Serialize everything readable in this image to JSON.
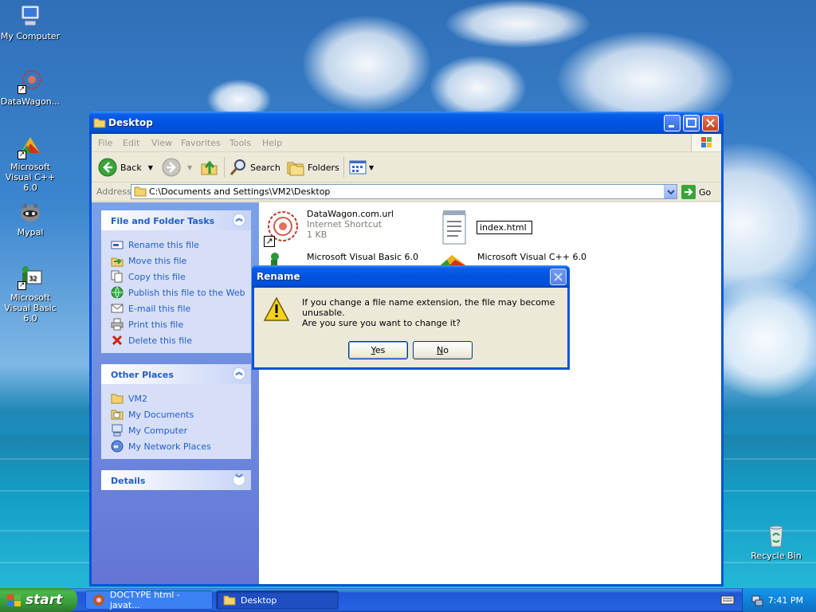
{
  "desktop": {
    "icons": [
      {
        "label": "My Computer"
      },
      {
        "label": "DataWagon..."
      },
      {
        "label": "Microsoft Visual C++ 6.0"
      },
      {
        "label": "Mypal"
      },
      {
        "label": "Microsoft Visual Basic 6.0"
      },
      {
        "label": "Recycle Bin"
      }
    ]
  },
  "explorer": {
    "title": "Desktop",
    "menu": [
      "File",
      "Edit",
      "View",
      "Favorites",
      "Tools",
      "Help"
    ],
    "toolbar": {
      "back": "Back",
      "search": "Search",
      "folders": "Folders"
    },
    "address": {
      "label": "Address",
      "value": "C:\\Documents and Settings\\VM2\\Desktop",
      "go": "Go"
    },
    "tasks": {
      "title": "File and Folder Tasks",
      "items": [
        "Rename this file",
        "Move this file",
        "Copy this file",
        "Publish this file to the Web",
        "E-mail this file",
        "Print this file",
        "Delete this file"
      ]
    },
    "other_places": {
      "title": "Other Places",
      "items": [
        "VM2",
        "My Documents",
        "My Computer",
        "My Network Places"
      ]
    },
    "details": {
      "title": "Details"
    },
    "files": [
      {
        "name": "DataWagon.com.url",
        "type": "Internet Shortcut",
        "size": "1 KB"
      },
      {
        "name": "index.html"
      },
      {
        "name": "Microsoft Visual Basic 6.0"
      },
      {
        "name": "Microsoft Visual C++ 6.0"
      }
    ]
  },
  "dialog": {
    "title": "Rename",
    "line1": "If you change a file name extension, the file may become unusable.",
    "line2": "Are you sure you want to change it?",
    "yes_prefix": "Y",
    "yes_rest": "es",
    "no_prefix": "N",
    "no_rest": "o"
  },
  "taskbar": {
    "start": "start",
    "tasks": [
      "DOCTYPE html - javat...",
      "Desktop"
    ],
    "clock": "7:41 PM"
  },
  "colors": {
    "link": "#215dc6",
    "titlebar": "#0053e1",
    "taskpane": "#6375d6",
    "start": "#3a9d3a"
  }
}
